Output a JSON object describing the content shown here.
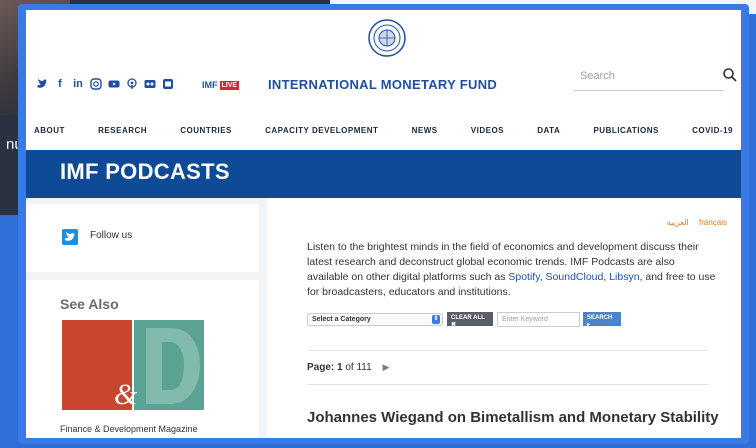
{
  "background": {
    "partial_text": "nu"
  },
  "header": {
    "imf_live": {
      "imf": "IMF",
      "live": "LIVE"
    },
    "brand": "INTERNATIONAL MONETARY FUND",
    "search_placeholder": "Search",
    "social_icons": [
      "twitter-icon",
      "facebook-icon",
      "linkedin-icon",
      "instagram-icon",
      "youtube-icon",
      "podcast-icon",
      "flickr-icon",
      "app-icon"
    ]
  },
  "nav": [
    "ABOUT",
    "RESEARCH",
    "COUNTRIES",
    "CAPACITY DEVELOPMENT",
    "NEWS",
    "VIDEOS",
    "DATA",
    "PUBLICATIONS",
    "COVID-19"
  ],
  "banner": {
    "title": "IMF PODCASTS"
  },
  "sidebar": {
    "follow_label": "Follow us",
    "see_also": "See Also",
    "fd_caption": "Finance & Development Magazine"
  },
  "content": {
    "languages": [
      "العربية",
      "français"
    ],
    "intro": {
      "text1": "Listen to the brightest minds in the field of economics and development discuss their latest research and deconstruct global economic trends. IMF Podcasts are also available on other digital platforms such as ",
      "link1": "Spotify",
      "sep1": ", ",
      "link2": "SoundCloud",
      "sep2": ", ",
      "link3": "Libsyn",
      "text2": ", and free to use for broadcasters, educators and institutions."
    },
    "filters": {
      "category": "Select a Category",
      "clear": "CLEAR ALL",
      "keyword_placeholder": "Enter Keyword",
      "search": "SEARCH"
    },
    "pager": {
      "label": "Page:",
      "current": "1",
      "of": "of",
      "total": "111"
    },
    "episode_title": "Johannes Wiegand on Bimetallism and Monetary Stability"
  },
  "colors": {
    "brand_blue": "#1f4f9e",
    "banner": "#0f4a96",
    "accent_orange": "#e07b1f",
    "frame": "#3a7ae6"
  }
}
